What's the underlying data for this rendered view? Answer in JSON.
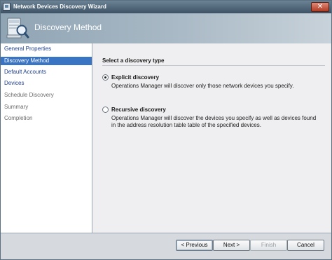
{
  "window": {
    "title": "Network Devices Discovery Wizard",
    "close_glyph": "✕"
  },
  "banner": {
    "title": "Discovery Method",
    "icon": "monitor-magnifier-icon"
  },
  "nav": {
    "items": [
      {
        "label": "General Properties",
        "state": "active"
      },
      {
        "label": "Discovery Method",
        "state": "selected"
      },
      {
        "label": "Default Accounts",
        "state": "active"
      },
      {
        "label": "Devices",
        "state": "active"
      },
      {
        "label": "Schedule Discovery",
        "state": "inactive"
      },
      {
        "label": "Summary",
        "state": "inactive"
      },
      {
        "label": "Completion",
        "state": "inactive"
      }
    ]
  },
  "main": {
    "section_title": "Select a discovery type",
    "options": [
      {
        "label": "Explicit discovery",
        "checked": true,
        "description": "Operations Manager will discover only those network devices you specify."
      },
      {
        "label": "Recursive discovery",
        "checked": false,
        "description": "Operations Manager will discover the devices you specify as well as devices found in the address resolution table table of the specified devices."
      }
    ]
  },
  "footer": {
    "previous_label": "< Previous",
    "next_label": "Next >",
    "finish_label": "Finish",
    "cancel_label": "Cancel"
  },
  "colors": {
    "selection": "#3a75c4",
    "banner": "#8fa4b4",
    "titlebar": "#3d5365"
  }
}
